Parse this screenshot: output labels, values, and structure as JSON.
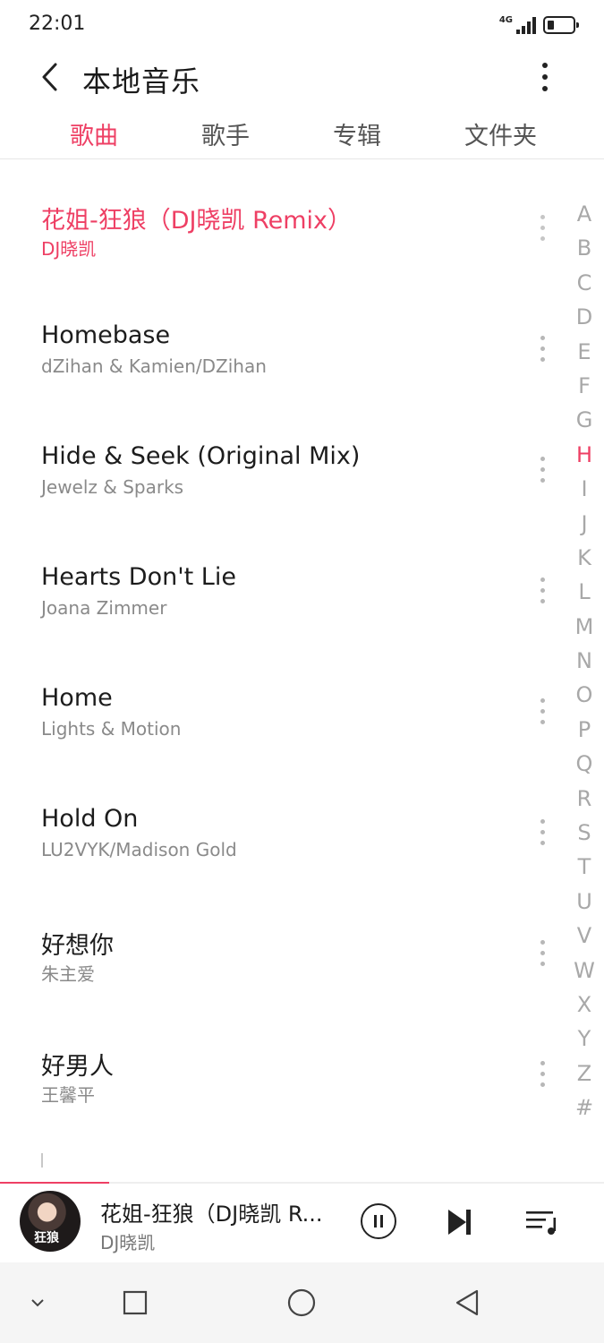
{
  "status_bar": {
    "time": "22:01",
    "network": "4G",
    "signal_bars": 4,
    "battery_level": 0.25
  },
  "header": {
    "title": "本地音乐",
    "back_icon": "chevron-left-icon",
    "more_icon": "vertical-ellipsis-icon"
  },
  "tabs": [
    {
      "label": "歌曲",
      "active": true
    },
    {
      "label": "歌手",
      "active": false
    },
    {
      "label": "专辑",
      "active": false
    },
    {
      "label": "文件夹",
      "active": false
    }
  ],
  "songs": [
    {
      "title": "花姐-狂狼（DJ晓凯 Remix）",
      "artist": "DJ晓凯",
      "playing": true
    },
    {
      "title": "Homebase",
      "artist": "dZihan & Kamien/DZihan",
      "playing": false
    },
    {
      "title": "Hide & Seek (Original Mix)",
      "artist": "Jewelz & Sparks",
      "playing": false
    },
    {
      "title": "Hearts Don't Lie",
      "artist": "Joana Zimmer",
      "playing": false
    },
    {
      "title": "Home",
      "artist": "Lights & Motion",
      "playing": false
    },
    {
      "title": "Hold On",
      "artist": "LU2VYK/Madison Gold",
      "playing": false
    },
    {
      "title": "好想你",
      "artist": "朱主爱",
      "playing": false
    },
    {
      "title": "好男人",
      "artist": "王馨平",
      "playing": false
    }
  ],
  "alphabet_index": {
    "letters": [
      "A",
      "B",
      "C",
      "D",
      "E",
      "F",
      "G",
      "H",
      "I",
      "J",
      "K",
      "L",
      "M",
      "N",
      "O",
      "P",
      "Q",
      "R",
      "S",
      "T",
      "U",
      "V",
      "W",
      "X",
      "Y",
      "Z",
      "#"
    ],
    "active": "H"
  },
  "now_playing": {
    "title": "花姐-狂狼（DJ晓凯 R...",
    "artist": "DJ晓凯",
    "cover_text": "狂狼",
    "progress": 0.18,
    "state": "playing",
    "icons": [
      "pause-icon",
      "next-track-icon",
      "playlist-icon"
    ]
  },
  "nav_bar": {
    "icons": [
      "collapse-chevron-icon",
      "recents-square-icon",
      "home-circle-icon",
      "back-triangle-icon"
    ]
  },
  "colors": {
    "accent": "#ee3f64",
    "text_primary": "#1c1c1c",
    "text_secondary": "#8a8a8a",
    "index_inactive": "#a8a8a8",
    "nav_background": "#f5f5f5"
  }
}
